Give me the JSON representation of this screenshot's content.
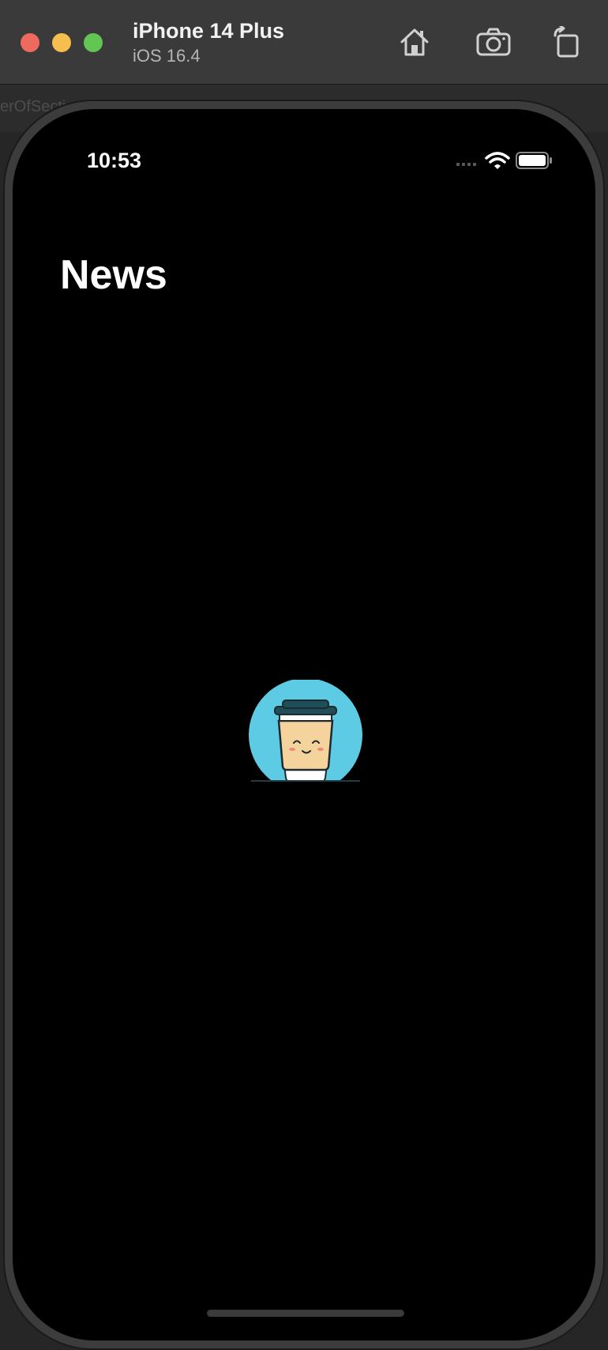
{
  "simulator": {
    "device_name": "iPhone 14 Plus",
    "os_version": "iOS 16.4",
    "toolbar_icons": [
      "home-icon",
      "camera-icon",
      "rotate-icon"
    ]
  },
  "backdrop": {
    "partial_text": "erOfSecti"
  },
  "status_bar": {
    "time": "10:53",
    "icons": [
      "cellular-signal-icon",
      "wifi-icon",
      "battery-icon"
    ]
  },
  "app": {
    "nav_title": "News",
    "placeholder_icon": "coffee-cup-icon"
  },
  "colors": {
    "illustration_circle": "#5ccbe3",
    "cup_body": "#f5d39c",
    "cup_lid": "#1e4e58"
  }
}
